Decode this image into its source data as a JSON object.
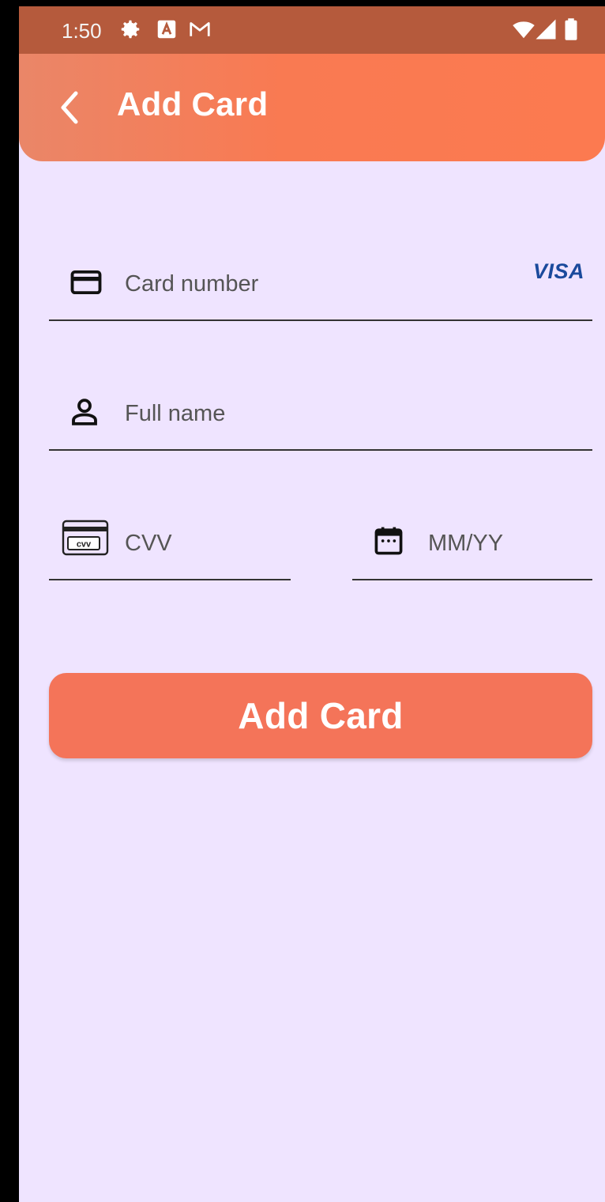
{
  "status_bar": {
    "time": "1:50",
    "left_icons": [
      "gear-icon",
      "a-icon",
      "gmail-icon"
    ],
    "right_icons": [
      "wifi-icon",
      "signal-icon",
      "battery-icon"
    ]
  },
  "app_bar": {
    "title": "Add Card",
    "back_icon": "chevron-left-icon",
    "gradient": [
      "#EA8668",
      "#FC7A50"
    ]
  },
  "form": {
    "card_number": {
      "placeholder": "Card number",
      "value": "",
      "icon": "credit-card-icon",
      "brand": "VISA"
    },
    "full_name": {
      "placeholder": "Full name",
      "value": "",
      "icon": "person-icon"
    },
    "cvv": {
      "placeholder": "CVV",
      "value": "",
      "icon": "cvv-card-icon",
      "icon_text": "cvv"
    },
    "expiry": {
      "placeholder": "MM/YY",
      "value": "",
      "icon": "calendar-icon"
    }
  },
  "submit": {
    "label": "Add Card",
    "color": "#F47459"
  },
  "theme": {
    "background": "#EFE4FF",
    "accent": "#F97A52"
  }
}
